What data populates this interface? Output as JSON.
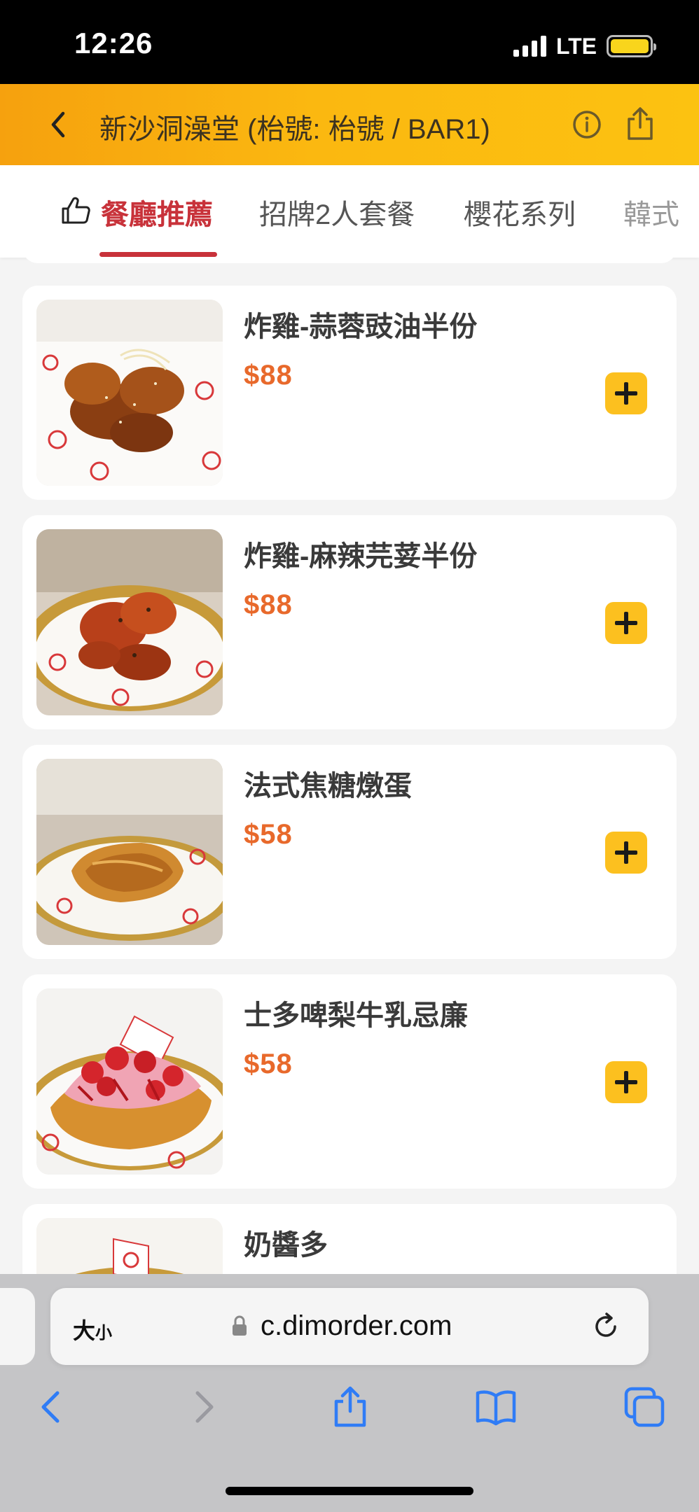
{
  "status_bar": {
    "time": "12:26",
    "network": "LTE"
  },
  "header": {
    "title": "新沙洞澡堂 (枱號: 枱號 / BAR1)",
    "accent_color": "#fbb810"
  },
  "tabs": [
    {
      "label": "餐廳推薦",
      "active": true,
      "icon": "thumbs-up-icon"
    },
    {
      "label": "招牌2人套餐",
      "active": false
    },
    {
      "label": "櫻花系列",
      "active": false
    },
    {
      "label": "韓式",
      "active": false
    }
  ],
  "menu_items": [
    {
      "name": "炸雞-蒜蓉豉油半份",
      "price": "$88",
      "image": "fried-chicken-garlic-soy-photo"
    },
    {
      "name": "炸雞-麻辣芫荽半份",
      "price": "$88",
      "image": "fried-chicken-spicy-coriander-photo"
    },
    {
      "name": "法式焦糖燉蛋",
      "price": "$58",
      "image": "creme-brulee-photo"
    },
    {
      "name": "士多啤梨牛乳忌廉",
      "price": "$58",
      "image": "strawberry-cream-waffle-photo"
    },
    {
      "name": "奶醬多",
      "price": "",
      "image": "condensed-milk-toast-photo"
    }
  ],
  "browser": {
    "text_size_label_big": "大",
    "text_size_label_small": "小",
    "url": "c.dimorder.com"
  },
  "colors": {
    "active_tab": "#c8323a",
    "price": "#e8692b",
    "add_button": "#fcc01f"
  }
}
